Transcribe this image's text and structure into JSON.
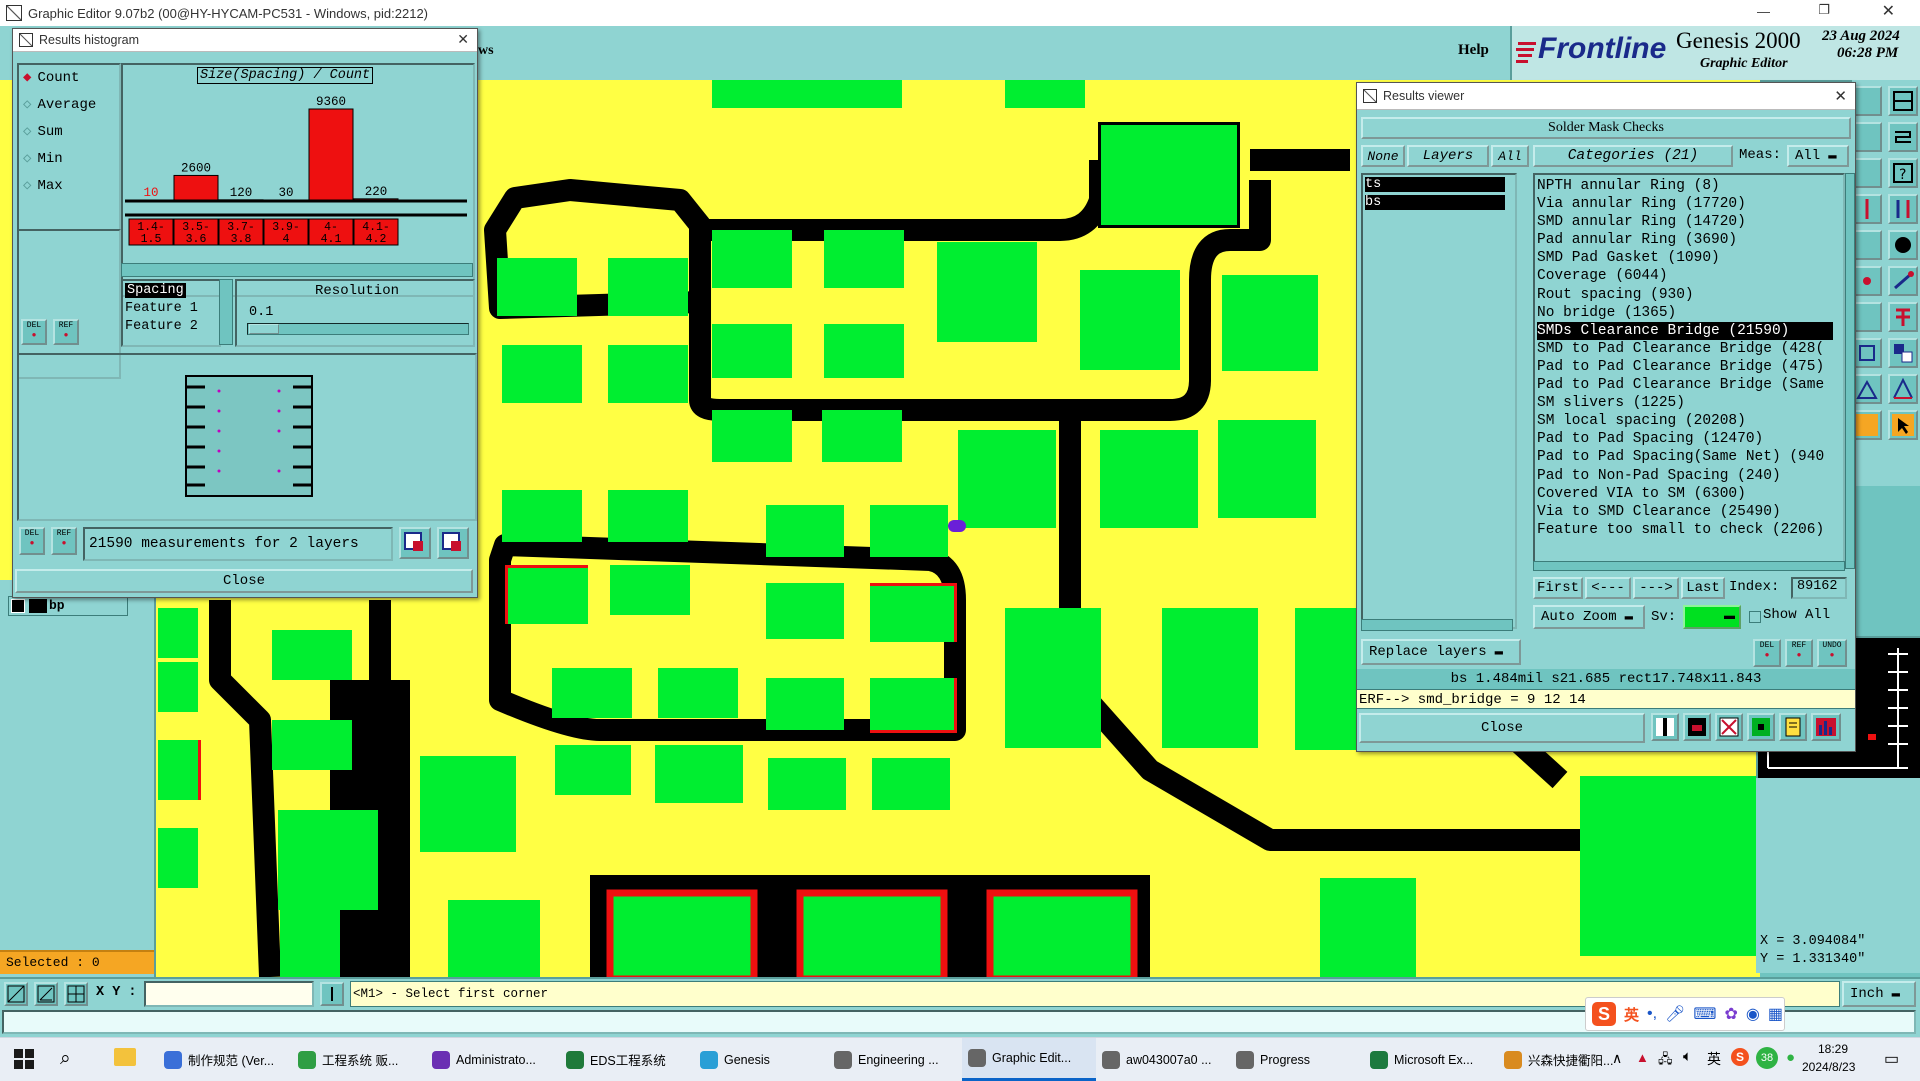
{
  "app": {
    "title": "Graphic Editor 9.07b2 (00@HY-HYCAM-PC531 - Windows, pid:2212)",
    "help": "Help",
    "brand": "Frontline",
    "product": "Genesis 2000",
    "product_sub": "Graphic Editor",
    "date": "23 Aug 2024",
    "time": "06:28 PM",
    "menu_fragment": "ws"
  },
  "histogram": {
    "title": "Results histogram",
    "options": [
      "Count",
      "Average",
      "Sum",
      "Min",
      "Max"
    ],
    "chart_title": "Size(Spacing) / Count",
    "chart_data": {
      "type": "bar",
      "categories": [
        "1.4-1.5",
        "3.5-3.6",
        "3.7-3.8",
        "3.9-4",
        "4-4.1",
        "4.1-4.2"
      ],
      "values": [
        10,
        2600,
        120,
        30,
        9360,
        220
      ],
      "value_labels": [
        "10",
        "2600",
        "120",
        "30",
        "9360",
        "220"
      ],
      "title": "Size(Spacing) / Count"
    },
    "cat_top": [
      "1.4-",
      "3.5-",
      "3.7-",
      "3.9-",
      "4-",
      "4.1-"
    ],
    "cat_bot": [
      "1.5",
      "3.6",
      "3.8",
      "4",
      "4.1",
      "4.2"
    ],
    "list_items": [
      "Spacing",
      "Feature 1",
      "Feature 2"
    ],
    "resolution_label": "Resolution",
    "resolution_value": "0.1",
    "measurements": "21590 measurements for 2 layers",
    "close": "Close",
    "del": "DEL",
    "ref": "REF"
  },
  "layer_row": "bp",
  "selected": "Selected : 0",
  "results": {
    "title": "Results viewer",
    "header": "Solder Mask Checks",
    "none": "None",
    "layers": "Layers",
    "all": "All",
    "categories": "Categories (21)",
    "meas_label": "Meas:",
    "meas_value": "All",
    "layer_items": [
      "ts",
      "bs"
    ],
    "items": [
      "NPTH annular Ring (8)",
      "Via annular Ring (17720)",
      "SMD annular Ring (14720)",
      "Pad annular Ring (3690)",
      "SMD Pad Gasket (1090)",
      "Coverage (6044)",
      "Rout spacing (930)",
      "No bridge (1365)",
      "SMDs Clearance Bridge (21590)",
      "SMD to Pad Clearance Bridge (428(",
      "Pad to Pad Clearance Bridge (475)",
      "Pad to Pad Clearance Bridge (Same",
      "SM slivers (1225)",
      "SM local spacing (20208)",
      "Pad to Pad Spacing (12470)",
      "Pad to Pad Spacing(Same Net) (940",
      "Pad to Non-Pad Spacing (240)",
      "Covered VIA to SM (6300)",
      "Via to SMD Clearance (25490)",
      "Feature too small to check (2206)"
    ],
    "first": "First",
    "prev": "<---",
    "next": "--->",
    "last": "Last",
    "index_label": "Index:",
    "index_value": "89162",
    "auto_zoom": "Auto Zoom",
    "sv": "Sv:",
    "show_all": "Show All",
    "replace_layers": "Replace layers",
    "status_line": "bs 1.484mil   s21.685   rect17.748x11.843",
    "erf_line": "ERF--> smd_bridge = 9 12 14",
    "close": "Close",
    "del": "DEL",
    "ref": "REF",
    "undo": "UNDO"
  },
  "coords": {
    "x": "X = 3.094084\"",
    "y": "Y = 1.331340\""
  },
  "bottom": {
    "xy_label": "X Y :",
    "xy_value": "",
    "prompt": "<M1> - Select first corner",
    "unit": "Inch"
  },
  "ime": {
    "lang": "英"
  },
  "taskbar": {
    "items": [
      "制作规范 (Ver...",
      "工程系统   贩...",
      "Administrato...",
      "EDS工程系统",
      "Genesis",
      "Engineering ...",
      "Graphic Edit...",
      "aw043007a0 ...",
      "Progress",
      "Microsoft Ex...",
      "兴森快捷衢阳..."
    ],
    "tray_lang": "英",
    "tray_badge": "38",
    "clock_time": "18:29",
    "clock_date": "2024/8/23"
  },
  "colors": {
    "teal": "#8fd4d2",
    "board_yellow": "#ffff44",
    "pad_green": "#00ee30",
    "bridge_red": "#ee1010"
  }
}
